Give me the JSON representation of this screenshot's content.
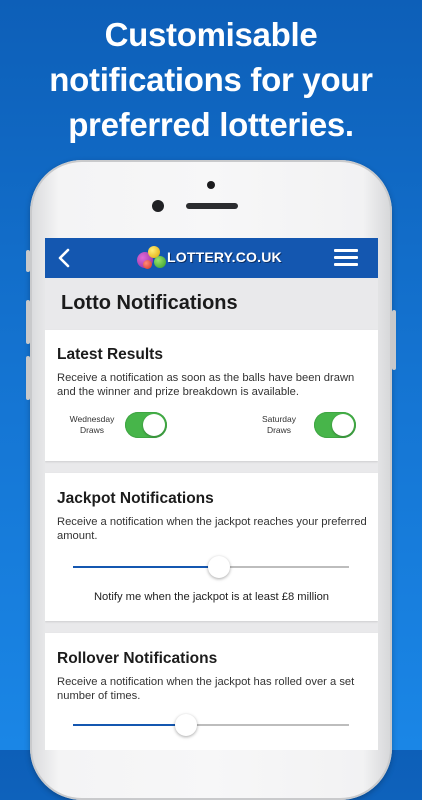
{
  "headline": {
    "line1": "Customisable",
    "line2": "notifications for your",
    "line3": "preferred lotteries."
  },
  "app_bar": {
    "back_icon": "chevron-left-icon",
    "logo_text": "LOTTERY.CO.UK",
    "menu_icon": "hamburger-menu-icon",
    "color": "#1457b0"
  },
  "page": {
    "title": "Lotto Notifications"
  },
  "latest_results": {
    "title": "Latest Results",
    "description": "Receive a notification as soon as the balls have been drawn and the winner and prize breakdown is available.",
    "toggles": [
      {
        "label_line1": "Wednesday",
        "label_line2": "Draws",
        "on": true
      },
      {
        "label_line1": "Saturday",
        "label_line2": "Draws",
        "on": true
      }
    ]
  },
  "jackpot": {
    "title": "Jackpot Notifications",
    "description": "Receive a notification when the jackpot reaches your preferred amount.",
    "slider_level": 0.53,
    "caption": "Notify me when the jackpot is at least £8 million"
  },
  "rollover": {
    "title": "Rollover Notifications",
    "description": "Receive a notification when the jackpot has rolled over a set number of times.",
    "slider_level": 0.41
  },
  "colors": {
    "toggle_on": "#47b54a",
    "slider_fill": "#1457b0"
  }
}
